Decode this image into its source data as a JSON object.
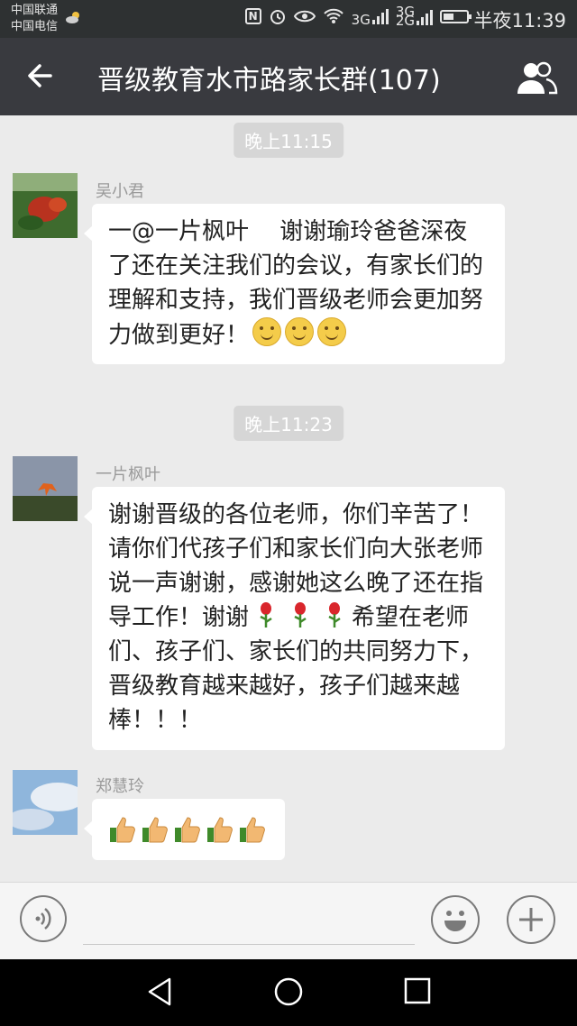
{
  "status_bar": {
    "carrier_1": "中国联通",
    "carrier_2": "中国电信",
    "network_1": "3G",
    "network_2": "3G",
    "network_2b": "2G",
    "time": "半夜11:39"
  },
  "header": {
    "title": "晋级教育水市路家长群(107)"
  },
  "messages": [
    {
      "type": "time",
      "text": "晚上11:15"
    },
    {
      "type": "msg",
      "sender": "吴小君",
      "text": "一@一片枫叶　 谢谢瑜玲爸爸深夜了还在关注我们的会议，有家长们的理解和支持，我们晋级老师会更加努力做到更好！",
      "emoji": [
        "smile-emoji",
        "smile-emoji",
        "smile-emoji"
      ]
    },
    {
      "type": "time",
      "text": "晚上11:23"
    },
    {
      "type": "msg",
      "sender": "一片枫叶",
      "text_part1": "谢谢晋级的各位老师，你们辛苦了！请你们代孩子们和家长们向大张老师说一声谢谢，感谢她这么晚了还在指导工作！谢谢",
      "text_part2": "希望在老师们、孩子们、家长们的共同努力下，晋级教育越来越好，孩子们越来越棒！！！",
      "emoji": [
        "rose-emoji",
        "rose-emoji",
        "rose-emoji"
      ]
    },
    {
      "type": "msg",
      "sender": "郑慧玲",
      "emoji": [
        "thumbs-up-emoji",
        "thumbs-up-emoji",
        "thumbs-up-emoji",
        "thumbs-up-emoji",
        "thumbs-up-emoji"
      ]
    }
  ],
  "colors": {
    "header_bg": "#393a3f",
    "chat_bg": "#ebebeb",
    "bubble_bg": "#ffffff",
    "time_badge_bg": "#d6d6d6"
  },
  "icons": {
    "back": "arrow-left-icon",
    "members": "group-members-icon",
    "voice": "voice-icon",
    "emoji": "emoji-icon",
    "plus": "plus-icon"
  }
}
